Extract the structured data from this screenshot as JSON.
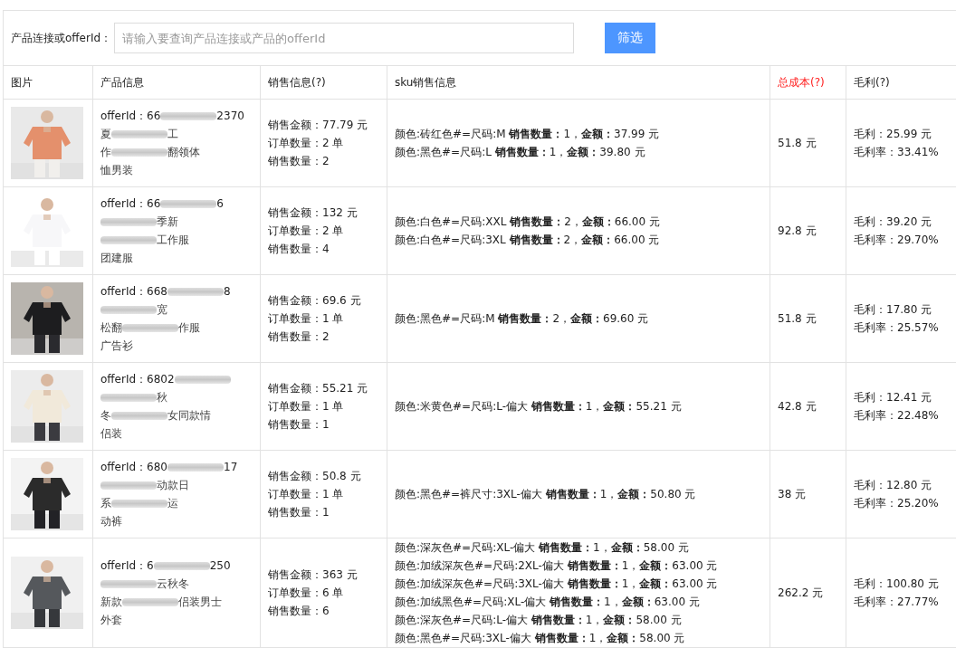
{
  "filter": {
    "label": "产品连接或offerId：",
    "placeholder": "请输入要查询产品连接或产品的offerId",
    "button": "筛选"
  },
  "table": {
    "columns": [
      {
        "label": "图片",
        "highlight": false
      },
      {
        "label": "产品信息",
        "highlight": false
      },
      {
        "label": "销售信息(?)",
        "highlight": false
      },
      {
        "label": "sku销售信息",
        "highlight": false
      },
      {
        "label": "总成本(?)",
        "highlight": true
      },
      {
        "label": "毛利(?)",
        "highlight": false
      }
    ],
    "rows": [
      {
        "picture": {
          "kind": "picture"
        },
        "offer": [
          {
            "kind": "text",
            "text": "offerId：66"
          },
          {
            "kind": "blur"
          },
          {
            "kind": "text",
            "text": "2370"
          }
        ],
        "title_lines": [
          [
            {
              "kind": "text",
              "text": "夏"
            },
            {
              "kind": "blur"
            },
            {
              "kind": "text",
              "text": "工"
            }
          ],
          [
            {
              "kind": "text",
              "text": "作"
            },
            {
              "kind": "blur"
            },
            {
              "kind": "text",
              "text": "翻领体"
            }
          ],
          [
            {
              "kind": "text",
              "text": "恤男装"
            }
          ]
        ],
        "sales": [
          "销售金额：77.79 元",
          "订单数量：2 单",
          "销售数量：2"
        ],
        "sku": [
          "颜色:砖红色#=尺码:M **销售数量：**1，**金额：**37.99 元",
          "颜色:黑色#=尺码:L **销售数量：**1，**金额：**39.80 元"
        ],
        "cost": "51.8 元",
        "profit": [
          "毛利：25.99 元",
          "毛利率：33.41%"
        ]
      },
      {
        "picture": {
          "kind": "picture"
        },
        "offer": [
          {
            "kind": "text",
            "text": "offerId：66"
          },
          {
            "kind": "blur"
          },
          {
            "kind": "text",
            "text": "6"
          }
        ],
        "title_lines": [
          [
            {
              "kind": "blur"
            },
            {
              "kind": "text",
              "text": "季新"
            }
          ],
          [
            {
              "kind": "blur"
            },
            {
              "kind": "text",
              "text": "工作服"
            }
          ],
          [
            {
              "kind": "text",
              "text": "团建服"
            }
          ]
        ],
        "sales": [
          "销售金额：132 元",
          "订单数量：2 单",
          "销售数量：4"
        ],
        "sku": [
          "颜色:白色#=尺码:XXL **销售数量：**2，**金额：**66.00 元",
          "颜色:白色#=尺码:3XL **销售数量：**2，**金额：**66.00 元"
        ],
        "cost": "92.8 元",
        "profit": [
          "毛利：39.20 元",
          "毛利率：29.70%"
        ]
      },
      {
        "picture": {
          "kind": "picture"
        },
        "offer": [
          {
            "kind": "text",
            "text": "offerId：668"
          },
          {
            "kind": "blur"
          },
          {
            "kind": "text",
            "text": "8"
          }
        ],
        "title_lines": [
          [
            {
              "kind": "blur"
            },
            {
              "kind": "text",
              "text": "宽"
            }
          ],
          [
            {
              "kind": "text",
              "text": "松翻"
            },
            {
              "kind": "blur"
            },
            {
              "kind": "text",
              "text": "作服"
            }
          ],
          [
            {
              "kind": "text",
              "text": "广告衫"
            }
          ]
        ],
        "sales": [
          "销售金额：69.6 元",
          "订单数量：1 单",
          "销售数量：2"
        ],
        "sku": [
          "颜色:黑色#=尺码:M **销售数量：**2，**金额：**69.60 元"
        ],
        "cost": "51.8 元",
        "profit": [
          "毛利：17.80 元",
          "毛利率：25.57%"
        ]
      },
      {
        "picture": {
          "kind": "picture"
        },
        "offer": [
          {
            "kind": "text",
            "text": "offerId：6802"
          },
          {
            "kind": "blur"
          }
        ],
        "title_lines": [
          [
            {
              "kind": "blur"
            },
            {
              "kind": "text",
              "text": "秋"
            }
          ],
          [
            {
              "kind": "text",
              "text": "冬"
            },
            {
              "kind": "blur"
            },
            {
              "kind": "text",
              "text": "女同款情"
            }
          ],
          [
            {
              "kind": "text",
              "text": "侣装"
            }
          ]
        ],
        "sales": [
          "销售金额：55.21 元",
          "订单数量：1 单",
          "销售数量：1"
        ],
        "sku": [
          "颜色:米黄色#=尺码:L-偏大 **销售数量：**1，**金额：**55.21 元"
        ],
        "cost": "42.8 元",
        "profit": [
          "毛利：12.41 元",
          "毛利率：22.48%"
        ]
      },
      {
        "picture": {
          "kind": "picture"
        },
        "offer": [
          {
            "kind": "text",
            "text": "offerId：680"
          },
          {
            "kind": "blur"
          },
          {
            "kind": "text",
            "text": "17"
          }
        ],
        "title_lines": [
          [
            {
              "kind": "blur"
            },
            {
              "kind": "text",
              "text": "动款日"
            }
          ],
          [
            {
              "kind": "text",
              "text": "系"
            },
            {
              "kind": "blur"
            },
            {
              "kind": "text",
              "text": "运"
            }
          ],
          [
            {
              "kind": "text",
              "text": "动裤"
            }
          ]
        ],
        "sales": [
          "销售金额：50.8 元",
          "订单数量：1 单",
          "销售数量：1"
        ],
        "sku": [
          "颜色:黑色#=裤尺寸:3XL-偏大 **销售数量：**1，**金额：**50.80 元"
        ],
        "cost": "38 元",
        "profit": [
          "毛利：12.80 元",
          "毛利率：25.20%"
        ]
      },
      {
        "picture": {
          "kind": "picture"
        },
        "offer": [
          {
            "kind": "text",
            "text": "offerId：6"
          },
          {
            "kind": "blur"
          },
          {
            "kind": "text",
            "text": "250"
          }
        ],
        "title_lines": [
          [
            {
              "kind": "blur"
            },
            {
              "kind": "text",
              "text": "云秋冬"
            }
          ],
          [
            {
              "kind": "text",
              "text": "新款"
            },
            {
              "kind": "blur"
            },
            {
              "kind": "text",
              "text": "侣装男士"
            }
          ],
          [
            {
              "kind": "text",
              "text": "外套"
            }
          ]
        ],
        "sales": [
          "销售金额：363 元",
          "订单数量：6 单",
          "销售数量：6"
        ],
        "sku": [
          "颜色:深灰色#=尺码:XL-偏大 **销售数量：**1，**金额：**58.00 元",
          "颜色:加绒深灰色#=尺码:2XL-偏大 **销售数量：**1，**金额：**63.00 元",
          "颜色:加绒深灰色#=尺码:3XL-偏大 **销售数量：**1，**金额：**63.00 元",
          "颜色:加绒黑色#=尺码:XL-偏大 **销售数量：**1，**金额：**63.00 元",
          "颜色:深灰色#=尺码:L-偏大 **销售数量：**1，**金额：**58.00 元",
          "颜色:黑色#=尺码:3XL-偏大 **销售数量：**1，**金额：**58.00 元"
        ],
        "cost": "262.2 元",
        "profit": [
          "毛利：100.80 元",
          "毛利率：27.77%"
        ]
      }
    ]
  }
}
